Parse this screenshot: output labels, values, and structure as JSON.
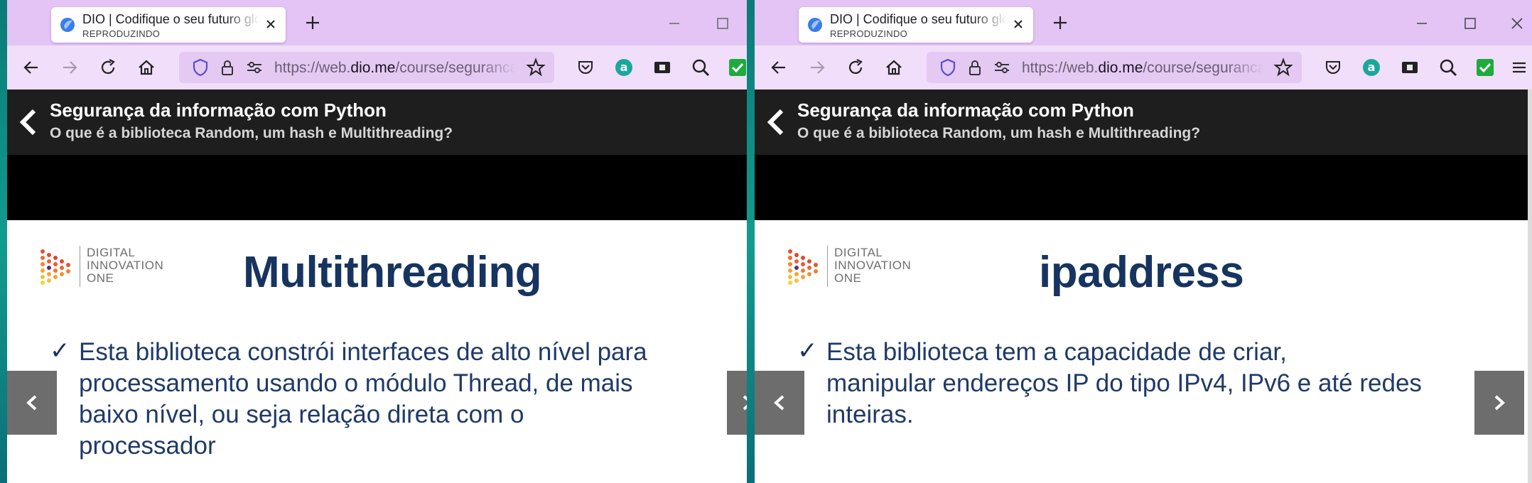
{
  "left": {
    "tab": {
      "title": "DIO | Codifique o seu futuro global agora",
      "subtitle": "REPRODUZINDO"
    },
    "url": {
      "prefix": "https://web.",
      "domain": "dio.me",
      "path": "/course/seguranca-da-informacao-com-python"
    },
    "course": {
      "title": "Segurança da informação com Python",
      "lesson": "O que é a biblioteca Random, um hash e Multithreading?"
    },
    "slide": {
      "logo_lines": [
        "DIGITAL",
        "INNOVATION",
        "ONE"
      ],
      "title": "Multithreading",
      "check": "✓",
      "lines": [
        "Esta biblioteca constrói interfaces de alto nível para",
        "processamento usando o módulo Thread, de mais",
        "baixo nível, ou seja relação direta com o",
        "processador"
      ]
    }
  },
  "right": {
    "tab": {
      "title": "DIO | Codifique o seu futuro global agora",
      "subtitle": "REPRODUZINDO"
    },
    "url": {
      "prefix": "https://web.",
      "domain": "dio.me",
      "path": "/course/seguranca-da-informacao-com-python"
    },
    "course": {
      "title": "Segurança da informação com Python",
      "lesson": "O que é a biblioteca Random, um hash e Multithreading?"
    },
    "slide": {
      "logo_lines": [
        "DIGITAL",
        "INNOVATION",
        "ONE"
      ],
      "title": "ipaddress",
      "check": "✓",
      "lines": [
        "Esta biblioteca tem a capacidade de criar,",
        "manipular endereços IP do tipo IPv4, IPv6 e até redes",
        "inteiras."
      ]
    }
  },
  "colors": {
    "tabbar": "#e3c4f4",
    "navbar": "#f1defb",
    "urlbar": "#e4c9f3",
    "header": "#1e1e1e",
    "slide_title": "#16345f",
    "bullet_text": "#1f3a67",
    "slide_nav": "#6d6d6d",
    "desktop": "#0b7a78"
  },
  "icons": [
    "dio-favicon",
    "close-icon",
    "plus-icon",
    "minimize-icon",
    "maximize-icon",
    "back-arrow-icon",
    "forward-arrow-icon",
    "reload-icon",
    "home-icon",
    "shield-icon",
    "lock-icon",
    "permissions-icon",
    "star-icon",
    "pocket-icon",
    "amazon-icon",
    "id-card-icon",
    "search-extension-icon",
    "check-extension-icon",
    "hamburger-menu-icon",
    "chevron-left-icon",
    "chevron-right-icon"
  ]
}
